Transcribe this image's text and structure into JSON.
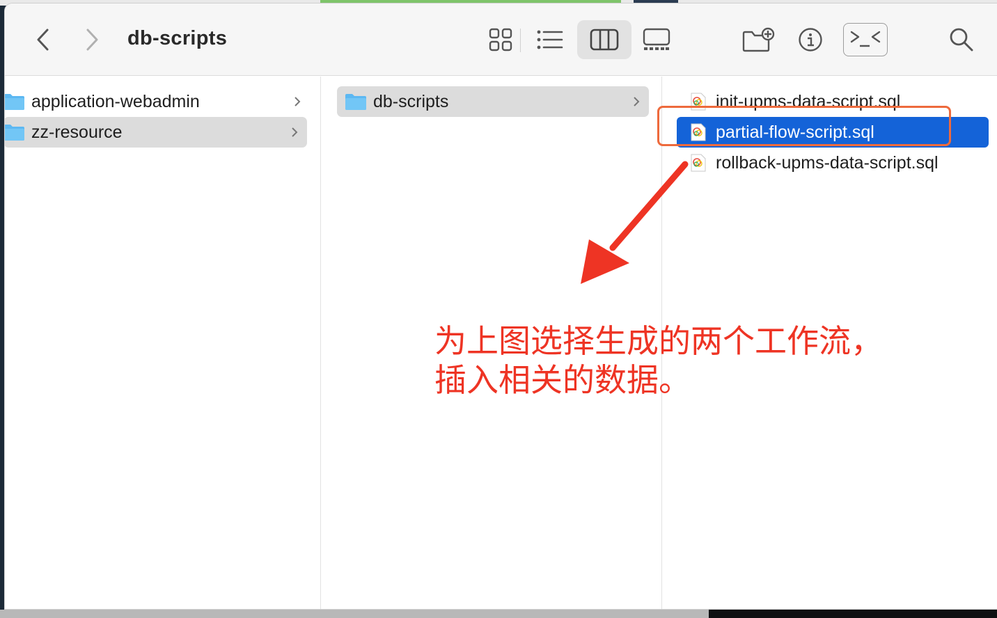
{
  "window": {
    "path_title": "db-scripts"
  },
  "toolbar": {
    "back_icon": "chevron-left-icon",
    "forward_icon": "chevron-right-icon",
    "view_modes": [
      "icon-view",
      "list-view",
      "column-view",
      "gallery-view"
    ],
    "active_view": "column-view"
  },
  "columns": [
    {
      "items": [
        {
          "label": "application-webadmin",
          "kind": "folder",
          "selected": false
        },
        {
          "label": "zz-resource",
          "kind": "folder",
          "selected": true
        }
      ]
    },
    {
      "items": [
        {
          "label": "db-scripts",
          "kind": "folder",
          "selected": true
        }
      ]
    },
    {
      "items": [
        {
          "label": "init-upms-data-script.sql",
          "kind": "file",
          "selected": false
        },
        {
          "label": "partial-flow-script.sql",
          "kind": "file",
          "selected": true
        },
        {
          "label": "rollback-upms-data-script.sql",
          "kind": "file",
          "selected": false
        }
      ]
    }
  ],
  "annotation": {
    "text": "为上图选择生成的两个工作流，\n插入相关的数据。",
    "color": "#ee3424",
    "box_color": "#ee6a3c"
  },
  "colors": {
    "selection_blue": "#1463d8",
    "selection_gray": "#dcdcdc",
    "folder_blue": "#5cb8f2"
  }
}
